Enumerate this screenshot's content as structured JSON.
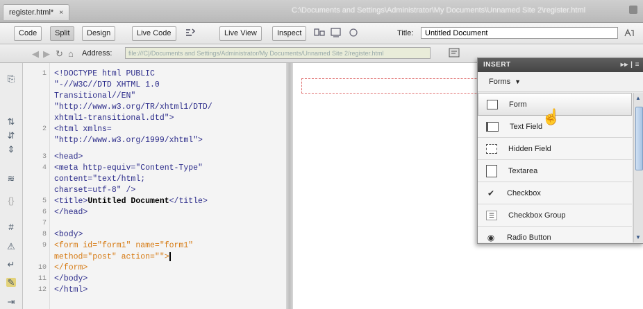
{
  "tab": {
    "filename": "register.html*",
    "close": "×"
  },
  "filepath": "C:\\Documents and Settings\\Administrator\\My Documents\\Unnamed Site 2\\register.html",
  "toolbar": {
    "code": "Code",
    "split": "Split",
    "design": "Design",
    "live_code": "Live Code",
    "live_view": "Live View",
    "inspect": "Inspect",
    "title_label": "Title:",
    "title_value": "Untitled Document"
  },
  "address": {
    "label": "Address:",
    "value": "file:///C|/Documents and Settings/Administrator/My Documents/Unnamed Site 2/register.html"
  },
  "code": {
    "lines": [
      {
        "num": "1",
        "text": "<!DOCTYPE html PUBLIC"
      },
      {
        "num": "",
        "text": "\"-//W3C//DTD XHTML 1.0"
      },
      {
        "num": "",
        "text": "Transitional//EN\""
      },
      {
        "num": "",
        "text": "\"http://www.w3.org/TR/xhtml1/DTD/"
      },
      {
        "num": "",
        "text": "xhtml1-transitional.dtd\">"
      },
      {
        "num": "2",
        "text": "<html xmlns="
      },
      {
        "num": "",
        "text": "\"http://www.w3.org/1999/xhtml\">"
      },
      {
        "num": "3",
        "text": "<head>"
      },
      {
        "num": "4",
        "text": "<meta http-equiv=\"Content-Type\""
      },
      {
        "num": "",
        "text": "content=\"text/html;"
      },
      {
        "num": "",
        "text": "charset=utf-8\" />"
      },
      {
        "num": "5",
        "text": "<title>"
      },
      {
        "num": "6",
        "text": "</head>"
      },
      {
        "num": "7",
        "text": ""
      },
      {
        "num": "8",
        "text": "<body>"
      },
      {
        "num": "9",
        "text": "<form id=\"form1\" name=\"form1\""
      },
      {
        "num": "",
        "text": "method=\"post\" action=\"\">"
      },
      {
        "num": "10",
        "text": "</form>"
      },
      {
        "num": "11",
        "text": "</body>"
      },
      {
        "num": "12",
        "text": "</html>"
      }
    ],
    "title_text": "Untitled Document",
    "title_close": "</title>"
  },
  "panel": {
    "header": "INSERT",
    "category": "Forms",
    "items": [
      "Form",
      "Text Field",
      "Hidden Field",
      "Textarea",
      "Checkbox",
      "Checkbox Group",
      "Radio Button"
    ]
  }
}
